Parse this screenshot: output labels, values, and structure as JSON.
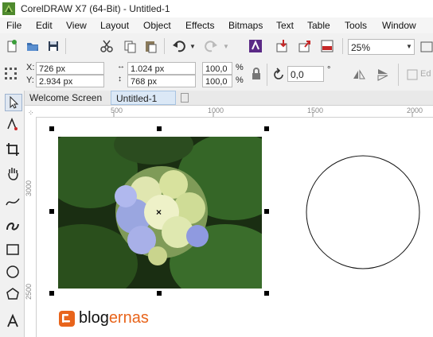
{
  "window": {
    "title": "CorelDRAW X7 (64-Bit) - Untitled-1"
  },
  "menu": [
    {
      "label": "File"
    },
    {
      "label": "Edit"
    },
    {
      "label": "View"
    },
    {
      "label": "Layout"
    },
    {
      "label": "Object"
    },
    {
      "label": "Effects"
    },
    {
      "label": "Bitmaps"
    },
    {
      "label": "Text"
    },
    {
      "label": "Table"
    },
    {
      "label": "Tools"
    },
    {
      "label": "Window"
    }
  ],
  "toolbar": {
    "zoom_value": "25%"
  },
  "properties": {
    "x_label": "X:",
    "x_value": "726 px",
    "y_label": "Y:",
    "y_value": "2.934 px",
    "width_value": "1.024 px",
    "height_value": "768 px",
    "scale_x": "100,0",
    "scale_y": "100,0",
    "percent_x": "%",
    "percent_y": "%",
    "rotation_value": "0,0",
    "rotation_unit": "°",
    "edit_label": "Ed"
  },
  "tabs": [
    {
      "label": "Welcome Screen"
    },
    {
      "label": "Untitled-1"
    }
  ],
  "ruler": {
    "h_ticks": [
      "500",
      "1000",
      "1500",
      "2000"
    ],
    "v_ticks": [
      "3000",
      "2500"
    ]
  },
  "watermark": {
    "text_a": "blog",
    "text_b": "ernas",
    "accent": "#e8641b"
  },
  "colors": {
    "accent": "#e8641b",
    "active_tab": "#dbe8f6"
  }
}
